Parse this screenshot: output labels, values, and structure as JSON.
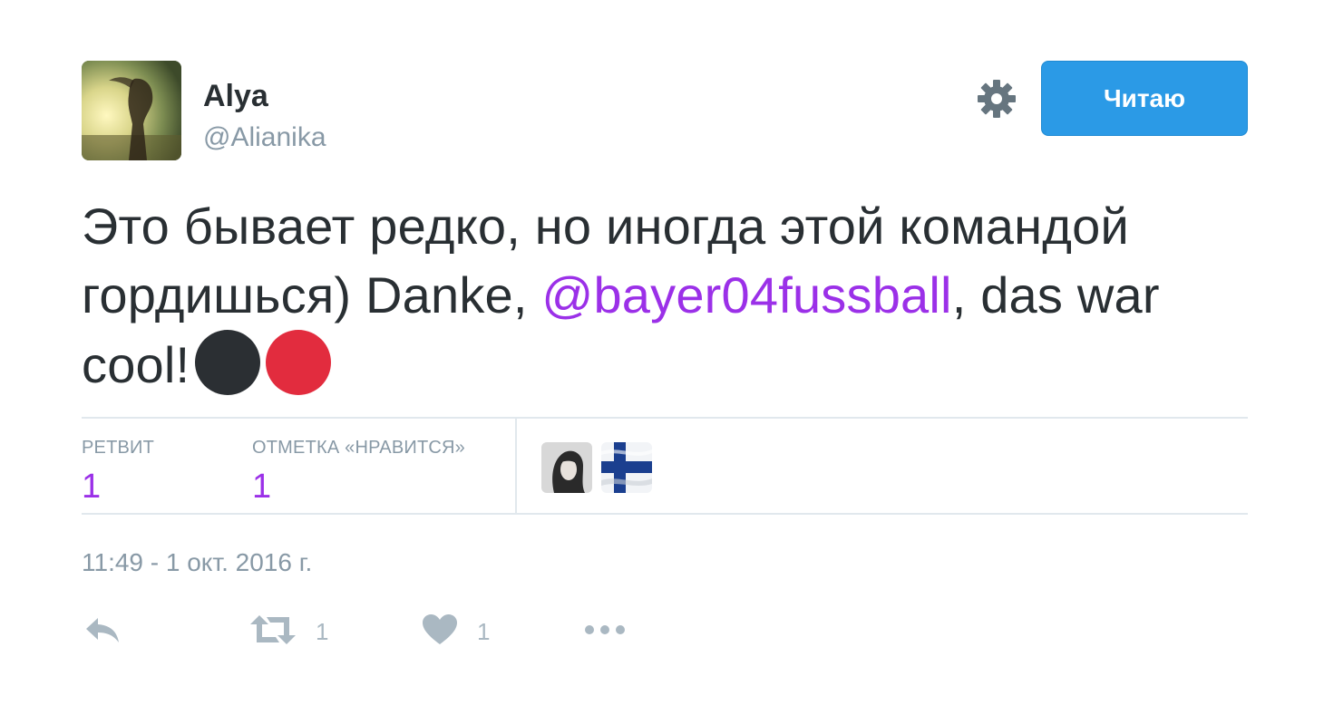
{
  "tweet": {
    "display_name": "Alya",
    "handle": "@Alianika",
    "follow_label": "Читаю",
    "text_part1": "Это бывает редко, но иногда этой командой гордишься) Danke, ",
    "mention": "@bayer04fussball",
    "text_part2": ", das war cool!",
    "emoji": [
      "black-circle",
      "red-circle"
    ],
    "timestamp": "11:49 - 1 окт. 2016 г."
  },
  "stats": {
    "retweets_label": "РЕТВИТ",
    "retweets_value": "1",
    "likes_label": "ОТМЕТКА «НРАВИТСЯ»",
    "likes_value": "1"
  },
  "actions": {
    "retweet_count": "1",
    "like_count": "1"
  },
  "colors": {
    "follow_button": "#2b9ae6",
    "mention": "#9b30e8",
    "secondary_text": "#8899a6",
    "divider": "#e1e8ed"
  },
  "icons": {
    "settings": "gear-icon",
    "reply": "reply-icon",
    "retweet": "retweet-icon",
    "like": "heart-icon",
    "more": "more-dots-icon"
  }
}
